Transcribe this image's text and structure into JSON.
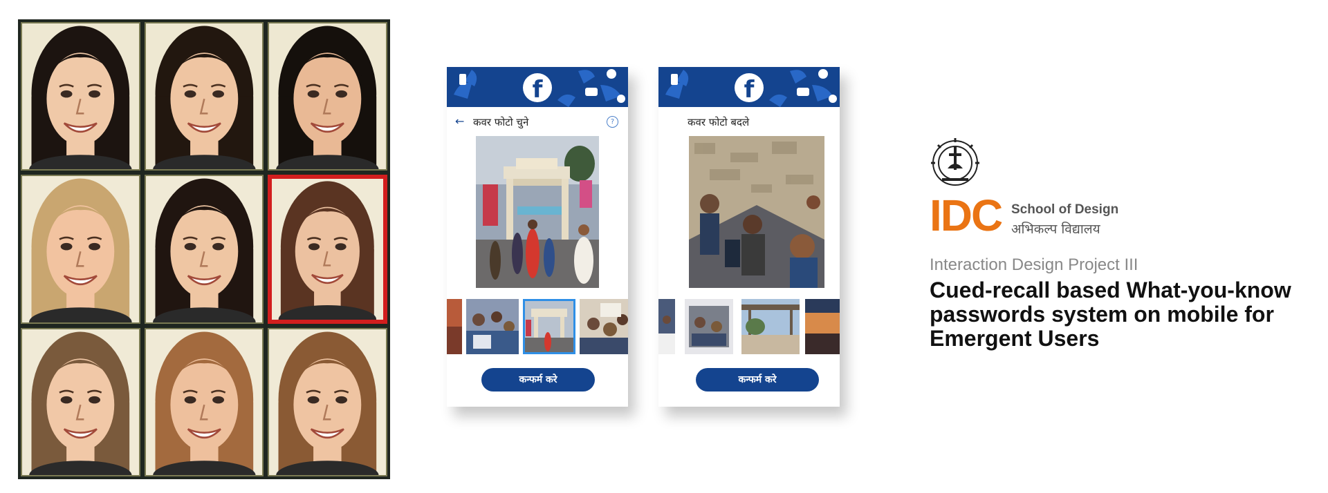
{
  "face_grid": {
    "faces": [
      {
        "skin": "#f0c9a8",
        "hair": "#1c1410",
        "bg": "#eee8d2",
        "selected": false
      },
      {
        "skin": "#efc5a2",
        "hair": "#22170f",
        "bg": "#eee8d2",
        "selected": false
      },
      {
        "skin": "#e9b995",
        "hair": "#15100c",
        "bg": "#eee8d2",
        "selected": false
      },
      {
        "skin": "#f2c3a0",
        "hair": "#c9a670",
        "bg": "#f0ead6",
        "selected": false
      },
      {
        "skin": "#efc6a3",
        "hair": "#201510",
        "bg": "#f0ead6",
        "selected": false
      },
      {
        "skin": "#ecc1a0",
        "hair": "#5a3422",
        "bg": "#f0ead6",
        "selected": true
      },
      {
        "skin": "#f1c8a7",
        "hair": "#7a5a3c",
        "bg": "#f0ead6",
        "selected": false
      },
      {
        "skin": "#eec09d",
        "hair": "#a36a3e",
        "bg": "#f0ead6",
        "selected": false
      },
      {
        "skin": "#efc4a2",
        "hair": "#8a5a34",
        "bg": "#f0ead6",
        "selected": false
      }
    ]
  },
  "phones": [
    {
      "title": "कवर फोटो चुने",
      "has_back": true,
      "has_help": true,
      "confirm_label": "कन्फर्म करे"
    },
    {
      "title": "कवर फोटो बदले",
      "has_back": false,
      "has_help": false,
      "confirm_label": "कन्फर्म करे"
    }
  ],
  "brand": {
    "facebook_letter": "f",
    "idc": "IDC",
    "school_en": "School of Design",
    "school_hi": "अभिकल्प विद्यालय"
  },
  "project": {
    "label": "Interaction Design Project III",
    "title_lines": [
      "Cued-recall based What-you-know",
      "passwords system on mobile for",
      "Emergent Users"
    ]
  },
  "colors": {
    "brand_blue": "#14448f",
    "idc_orange": "#ea7414",
    "selection_red": "#d21e1e",
    "thumb_active": "#2f8fe6"
  }
}
